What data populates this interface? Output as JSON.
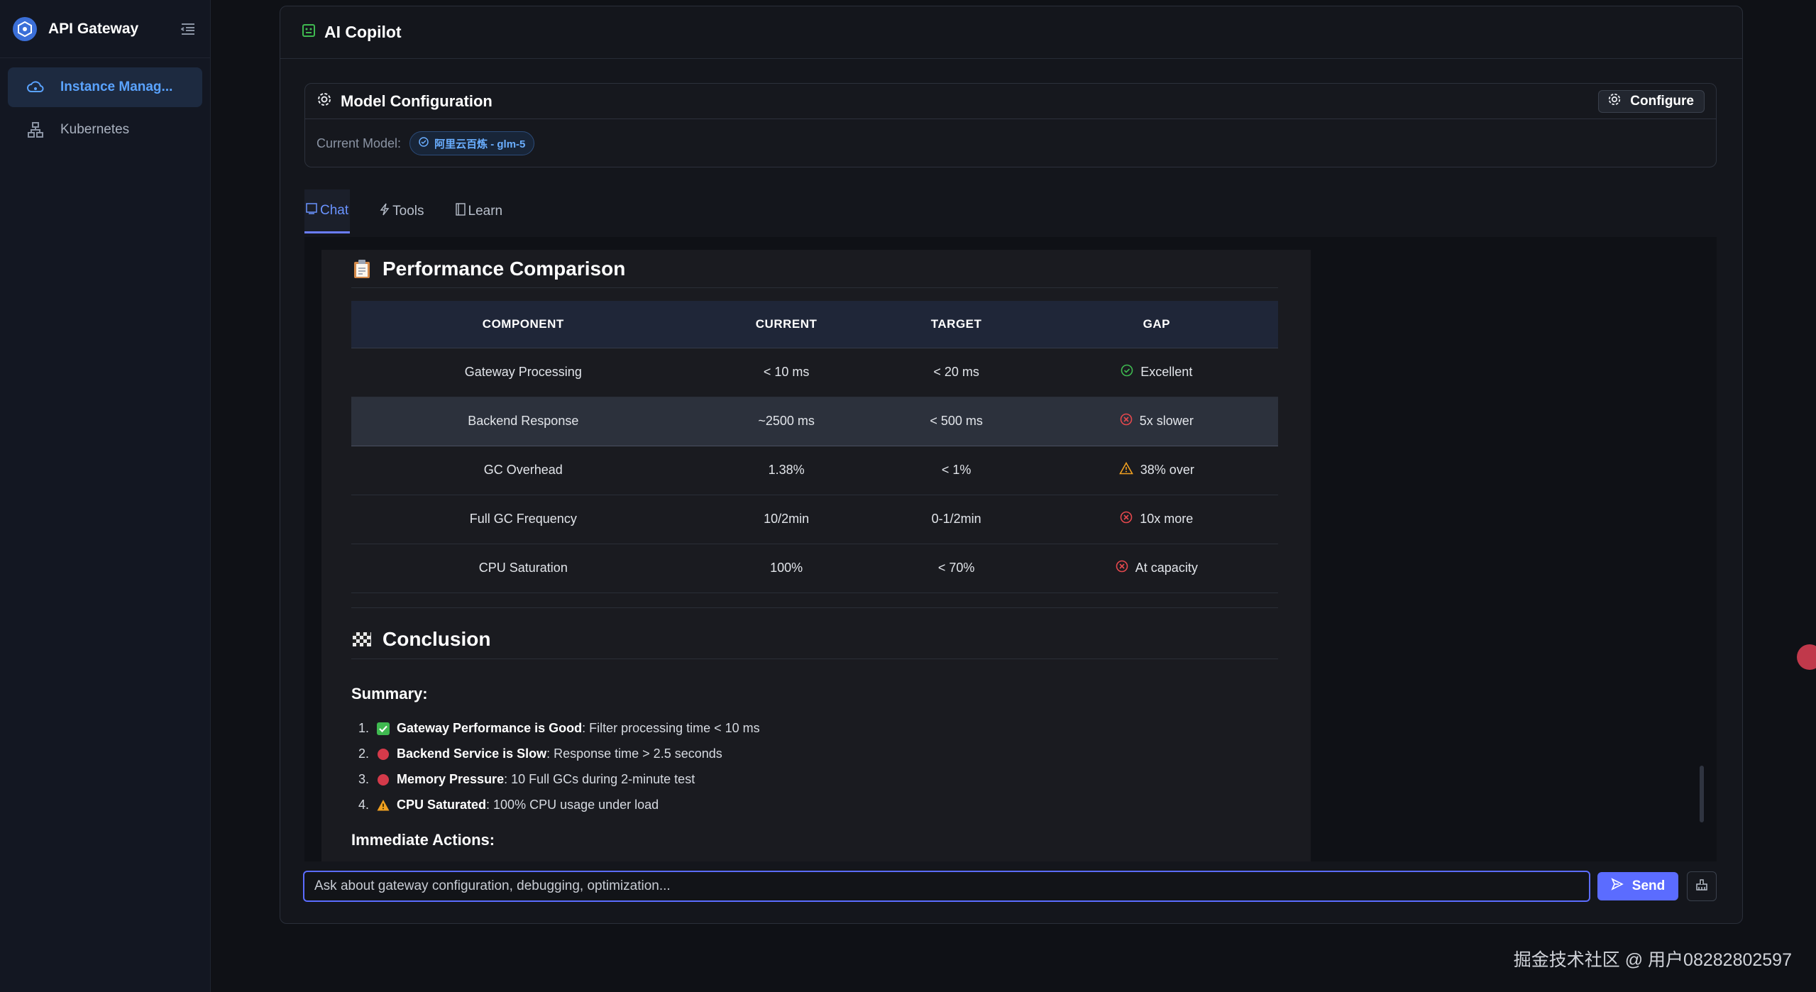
{
  "sidebar": {
    "title": "API Gateway",
    "items": [
      {
        "label": "Instance Manag...",
        "icon": "cloud-icon",
        "active": true
      },
      {
        "label": "Kubernetes",
        "icon": "cluster-icon",
        "active": false
      }
    ]
  },
  "panel": {
    "title": "AI Copilot",
    "model_card": {
      "title": "Model Configuration",
      "configure_label": "Configure",
      "current_model_label": "Current Model:",
      "current_model_value": "阿里云百炼 - glm-5"
    },
    "tabs": [
      {
        "label": "Chat",
        "active": true
      },
      {
        "label": "Tools",
        "active": false
      },
      {
        "label": "Learn",
        "active": false
      }
    ]
  },
  "message": {
    "perf_heading": "Performance Comparison",
    "table": {
      "headers": [
        "COMPONENT",
        "CURRENT",
        "TARGET",
        "GAP"
      ],
      "rows": [
        {
          "component": "Gateway Processing",
          "current": "< 10 ms",
          "target": "< 20 ms",
          "gap": "Excellent",
          "status": "ok"
        },
        {
          "component": "Backend Response",
          "current": "~2500 ms",
          "target": "< 500 ms",
          "gap": "5x slower",
          "status": "bad"
        },
        {
          "component": "GC Overhead",
          "current": "1.38%",
          "target": "< 1%",
          "gap": "38% over",
          "status": "warn"
        },
        {
          "component": "Full GC Frequency",
          "current": "10/2min",
          "target": "0-1/2min",
          "gap": "10x more",
          "status": "bad"
        },
        {
          "component": "CPU Saturation",
          "current": "100%",
          "target": "< 70%",
          "gap": "At capacity",
          "status": "bad"
        }
      ]
    },
    "conclusion_heading": "Conclusion",
    "summary_heading": "Summary:",
    "summary_items": [
      {
        "num": "1.",
        "badge": "check",
        "bold": "Gateway Performance is Good",
        "text": ": Filter processing time < 10 ms"
      },
      {
        "num": "2.",
        "badge": "red-circle",
        "bold": "Backend Service is Slow",
        "text": ": Response time > 2.5 seconds"
      },
      {
        "num": "3.",
        "badge": "red-circle",
        "bold": "Memory Pressure",
        "text": ": 10 Full GCs during 2-minute test"
      },
      {
        "num": "4.",
        "badge": "warning",
        "bold": "CPU Saturated",
        "text": ": 100% CPU usage under load"
      }
    ],
    "actions_heading": "Immediate Actions:"
  },
  "input": {
    "placeholder": "Ask about gateway configuration, debugging, optimization...",
    "send_label": "Send"
  },
  "watermark": "掘金技术社区 @ 用户08282802597",
  "colors": {
    "accent": "#5b6cff",
    "ok": "#3fb950",
    "bad": "#e5484d",
    "warn": "#f0a020",
    "link": "#5aa3ff"
  }
}
